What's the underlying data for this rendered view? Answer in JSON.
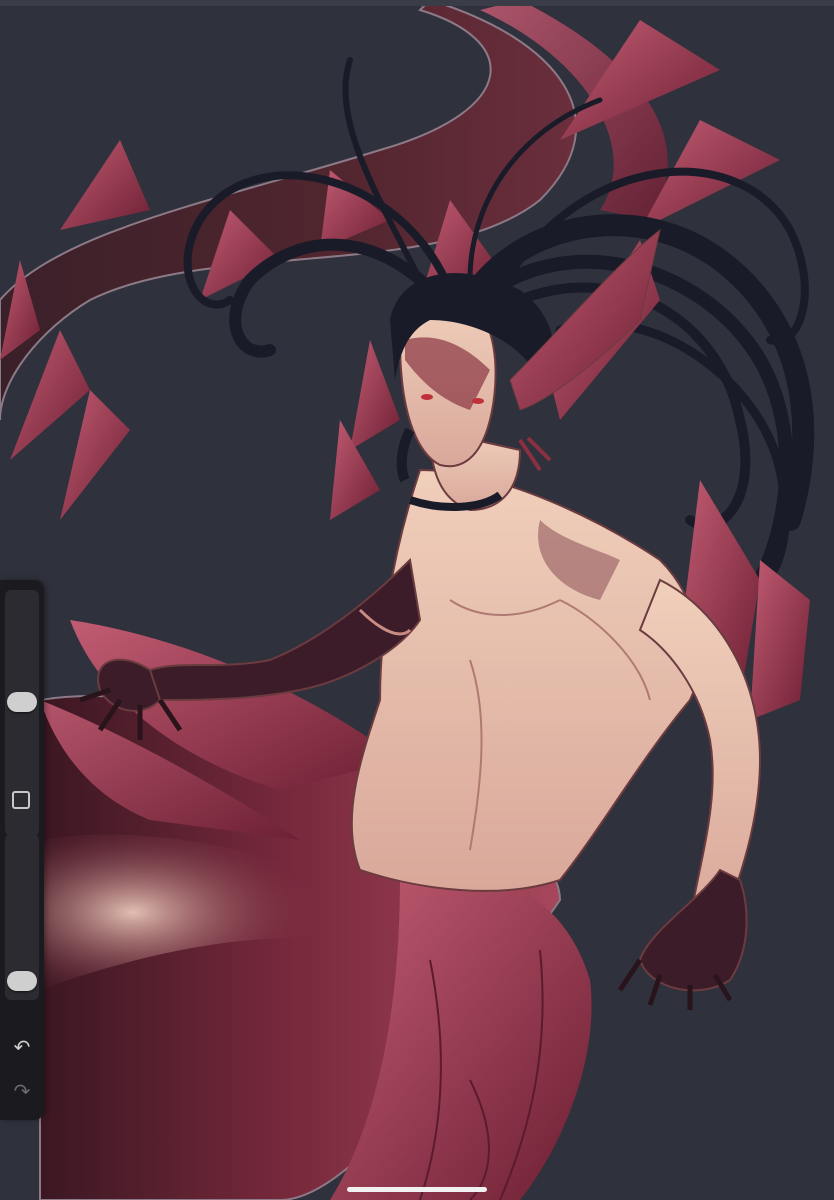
{
  "app": {
    "type": "drawing-canvas",
    "canvas_background": "#2f313c"
  },
  "toolbar": {
    "brush_size_level": 0.55,
    "brush_opacity_level": 0.05,
    "modify_icon": "square-icon",
    "undo_icon": "undo-icon",
    "redo_icon": "redo-icon",
    "undo_glyph": "↶",
    "redo_glyph": "↷",
    "redo_enabled": false
  },
  "colors": {
    "fin_red": "#8a2f45",
    "fin_light": "#b14b63",
    "skin": "#e8c3ad",
    "hair": "#1a1b28",
    "toolbar_bg": "#1b1b1f"
  }
}
